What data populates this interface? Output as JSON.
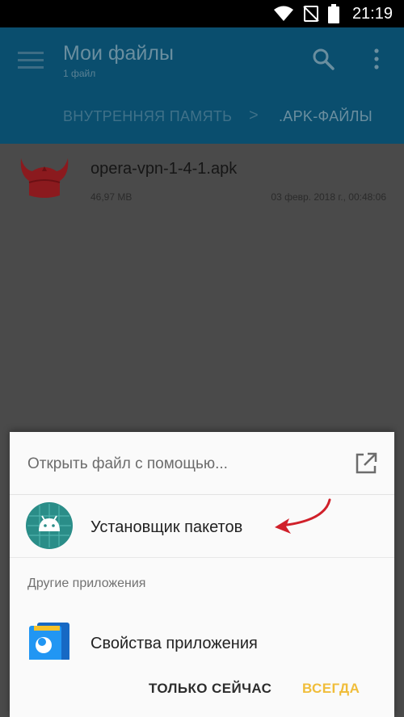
{
  "status_bar": {
    "time": "21:19",
    "icons": [
      "wifi-icon",
      "no-sim-icon",
      "battery-icon"
    ]
  },
  "app_bar": {
    "title": "Мои файлы",
    "subtitle": "1 файл",
    "icons": [
      "menu-icon",
      "search-icon",
      "more-icon"
    ],
    "breadcrumb": [
      "ВНУТРЕННЯЯ ПАМЯТЬ",
      ".APK-ФАЙЛЫ"
    ],
    "breadcrumb_separator": ">"
  },
  "files": [
    {
      "name": "opera-vpn-1-4-1.apk",
      "size": "46,97 MB",
      "date": "03 февр. 2018 г., 00:48:06",
      "icon": "opera-vpn-icon"
    }
  ],
  "dialog": {
    "title": "Открыть файл с помощью...",
    "header_icon": "open-external-icon",
    "primary_option": {
      "label": "Установщик пакетов",
      "icon": "android-icon"
    },
    "section_label": "Другие приложения",
    "other_option": {
      "label": "Свойства приложения",
      "icon": "app-properties-icon"
    },
    "actions": {
      "once": "ТОЛЬКО СЕЙЧАС",
      "always": "ВСЕГДА"
    }
  },
  "colors": {
    "app_bar": "#0a4e6e",
    "scrim": "#4a4a4a",
    "android_teal": "#2a8d88",
    "accent_yellow": "#f0bd3a",
    "annotation_red": "#d0202a",
    "opera_red": "#8b1a1e"
  }
}
